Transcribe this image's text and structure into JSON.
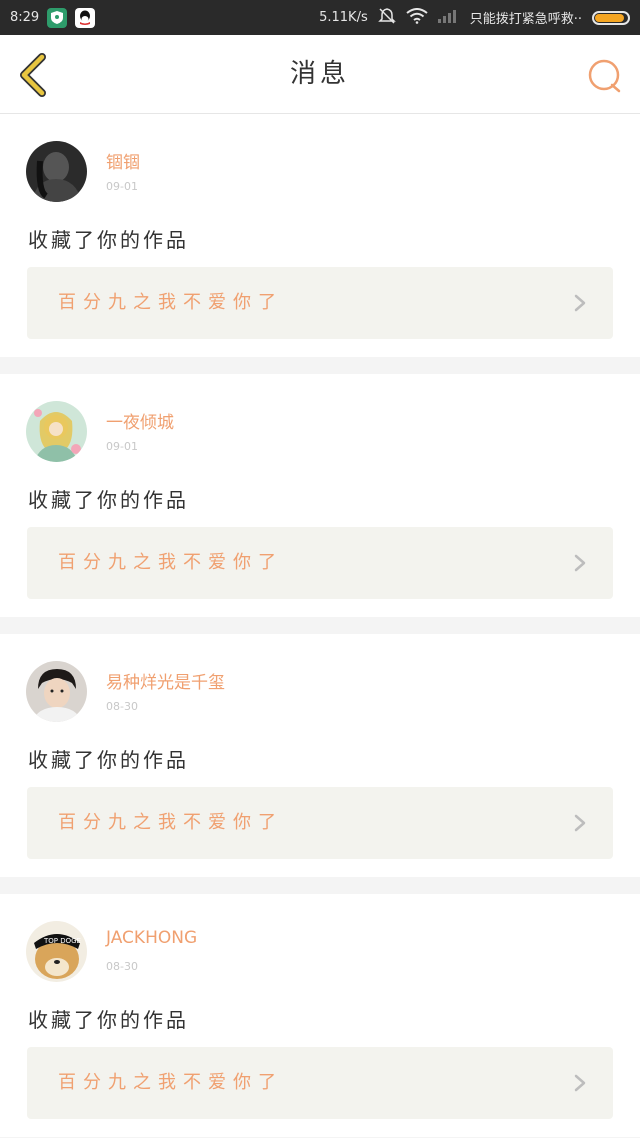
{
  "status_bar": {
    "time": "8:29",
    "speed": "5.11K/s",
    "carrier_text": "只能拨打紧急呼救··"
  },
  "header": {
    "title": "消息"
  },
  "colors": {
    "accent": "#f0a070",
    "back_arrow": "#e8c640",
    "card_bg": "#f3f3ee"
  },
  "messages": [
    {
      "username": "锢锢",
      "date": "09-01",
      "action": "收藏了你的作品",
      "work_title": "百分九之我不爱你了"
    },
    {
      "username": "一夜倾城",
      "date": "09-01",
      "action": "收藏了你的作品",
      "work_title": "百分九之我不爱你了"
    },
    {
      "username": "易种烊光是千玺",
      "date": "08-30",
      "action": "收藏了你的作品",
      "work_title": "百分九之我不爱你了"
    },
    {
      "username": "JACKHONG",
      "date": "08-30",
      "action": "收藏了你的作品",
      "work_title": "百分九之我不爱你了"
    }
  ]
}
